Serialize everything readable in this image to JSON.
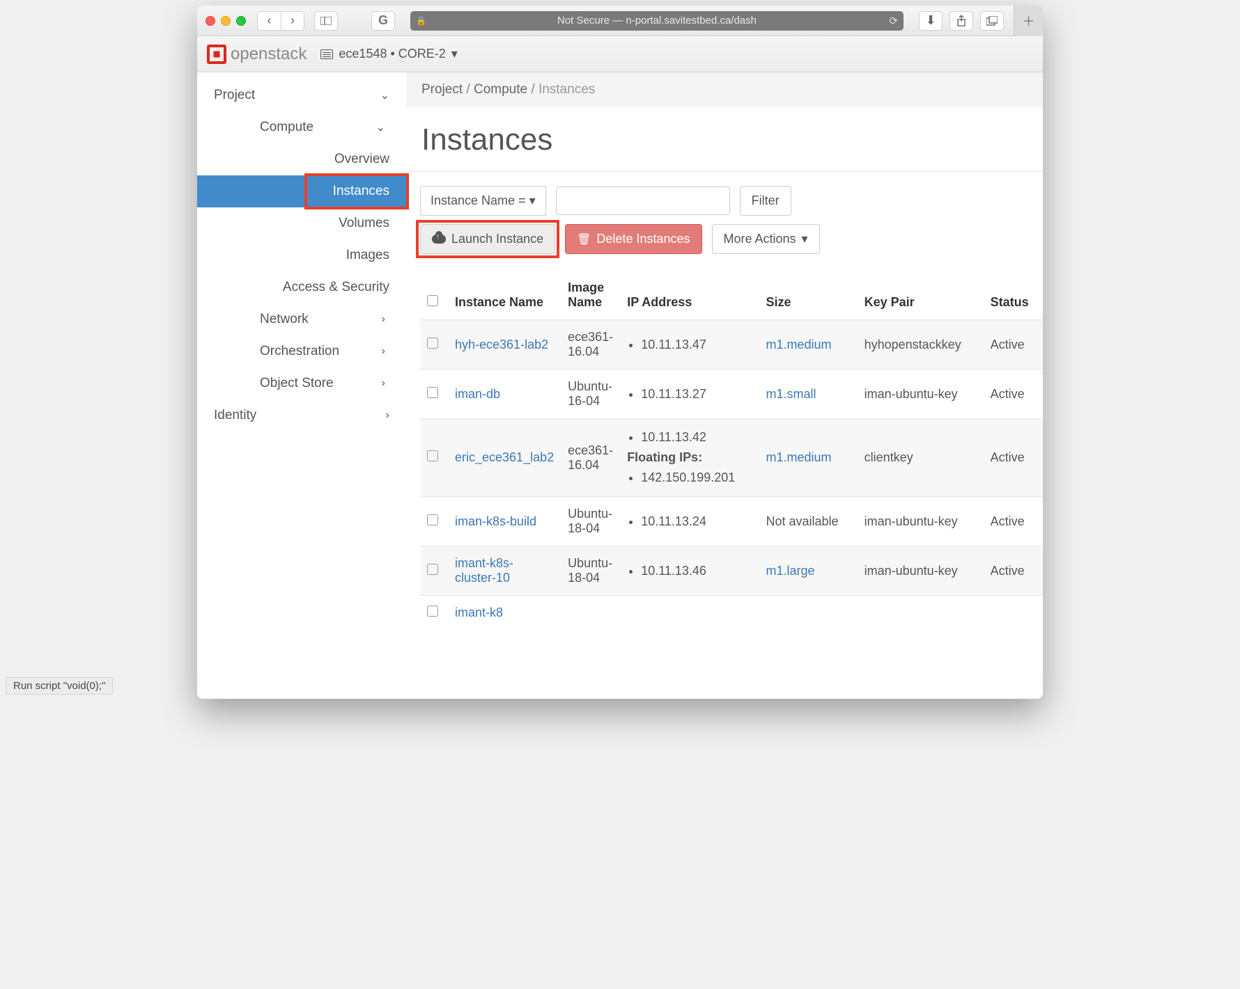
{
  "browser": {
    "address": "Not Secure — n-portal.savitestbed.ca/dash",
    "status_hint": "Run script \"void(0);\""
  },
  "topbar": {
    "brand": "openstack",
    "context": "ece1548 • CORE-2"
  },
  "sidebar": {
    "project": "Project",
    "compute": "Compute",
    "compute_items": [
      "Overview",
      "Instances",
      "Volumes",
      "Images",
      "Access & Security"
    ],
    "network": "Network",
    "orchestration": "Orchestration",
    "object_store": "Object Store",
    "identity": "Identity"
  },
  "breadcrumb": {
    "a": "Project",
    "b": "Compute",
    "c": "Instances"
  },
  "page_title": "Instances",
  "toolbar": {
    "filter_select": "Instance Name =",
    "filter_btn": "Filter",
    "launch": "Launch Instance",
    "delete": "Delete Instances",
    "more": "More Actions"
  },
  "table": {
    "headers": {
      "name": "Instance Name",
      "image": "Image Name",
      "ip": "IP Address",
      "size": "Size",
      "key": "Key Pair",
      "status": "Status"
    },
    "rows": [
      {
        "name": "hyh-ece361-lab2",
        "image": "ece361-16.04",
        "ips": [
          "10.11.13.47"
        ],
        "floating_ips": [],
        "size": "m1.medium",
        "size_link": true,
        "key": "hyhopenstackkey",
        "status": "Active"
      },
      {
        "name": "iman-db",
        "image": "Ubuntu-16-04",
        "ips": [
          "10.11.13.27"
        ],
        "floating_ips": [],
        "size": "m1.small",
        "size_link": true,
        "key": "iman-ubuntu-key",
        "status": "Active"
      },
      {
        "name": "eric_ece361_lab2",
        "image": "ece361-16.04",
        "ips": [
          "10.11.13.42"
        ],
        "floating_label": "Floating IPs:",
        "floating_ips": [
          "142.150.199.201"
        ],
        "size": "m1.medium",
        "size_link": true,
        "key": "clientkey",
        "status": "Active"
      },
      {
        "name": "iman-k8s-build",
        "image": "Ubuntu-18-04",
        "ips": [
          "10.11.13.24"
        ],
        "floating_ips": [],
        "size": "Not available",
        "size_link": false,
        "key": "iman-ubuntu-key",
        "status": "Active"
      },
      {
        "name": "imant-k8s-cluster-10",
        "image": "Ubuntu-18-04",
        "ips": [
          "10.11.13.46"
        ],
        "floating_ips": [],
        "size": "m1.large",
        "size_link": true,
        "key": "iman-ubuntu-key",
        "status": "Active"
      },
      {
        "name": "imant-k8",
        "image": "",
        "ips": [],
        "floating_ips": [],
        "size": "",
        "size_link": false,
        "key": "",
        "status": ""
      }
    ]
  }
}
